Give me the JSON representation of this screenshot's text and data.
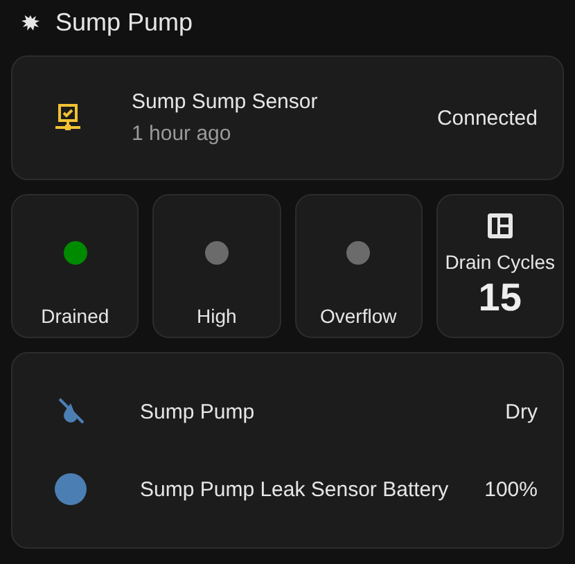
{
  "header": {
    "title": "Sump Pump"
  },
  "sensor": {
    "name": "Sump Sump Sensor",
    "time": "1 hour ago",
    "status": "Connected"
  },
  "indicators": [
    {
      "label": "Drained",
      "color": "#008a00"
    },
    {
      "label": "High",
      "color": "#6b6b6b"
    },
    {
      "label": "Overflow",
      "color": "#6b6b6b"
    }
  ],
  "counter": {
    "label": "Drain Cycles",
    "value": "15"
  },
  "entities": [
    {
      "kind": "water-off",
      "name": "Sump Pump",
      "state": "Dry"
    },
    {
      "kind": "battery",
      "name": "Sump Pump Leak Sensor Battery",
      "state": "100%"
    }
  ]
}
